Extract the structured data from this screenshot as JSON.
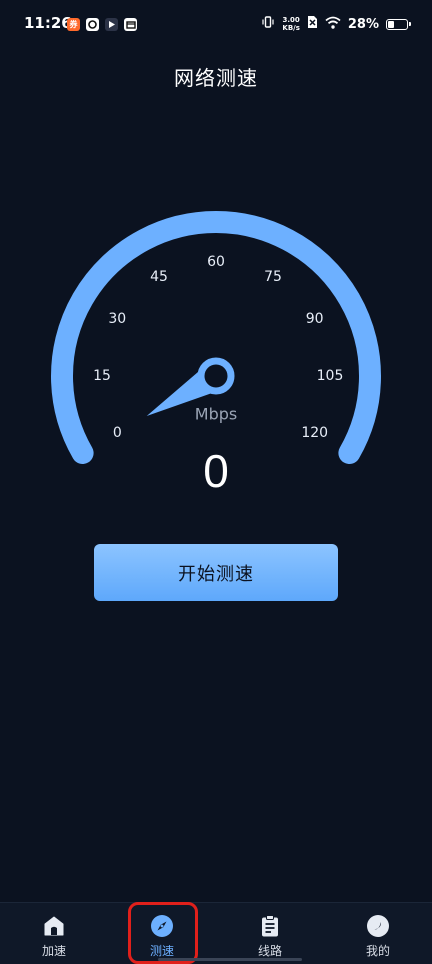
{
  "status_bar": {
    "time": "11:26",
    "net_speed_value": "3.00",
    "net_speed_unit": "KB/s",
    "battery_percent": "28%",
    "battery_level": 0.28
  },
  "page": {
    "title": "网络测速"
  },
  "gauge": {
    "ticks": [
      "0",
      "15",
      "30",
      "45",
      "60",
      "75",
      "90",
      "105",
      "120"
    ],
    "unit": "Mbps",
    "value": "0",
    "arc_color": "#6db0ff"
  },
  "start_button": {
    "label": "开始测速"
  },
  "bottom_nav": {
    "items": [
      {
        "label": "加速",
        "icon": "home-icon"
      },
      {
        "label": "测速",
        "icon": "compass-icon"
      },
      {
        "label": "线路",
        "icon": "clipboard-icon"
      },
      {
        "label": "我的",
        "icon": "moon-icon"
      }
    ],
    "active_index": 1,
    "active_color": "#6db0ff"
  }
}
